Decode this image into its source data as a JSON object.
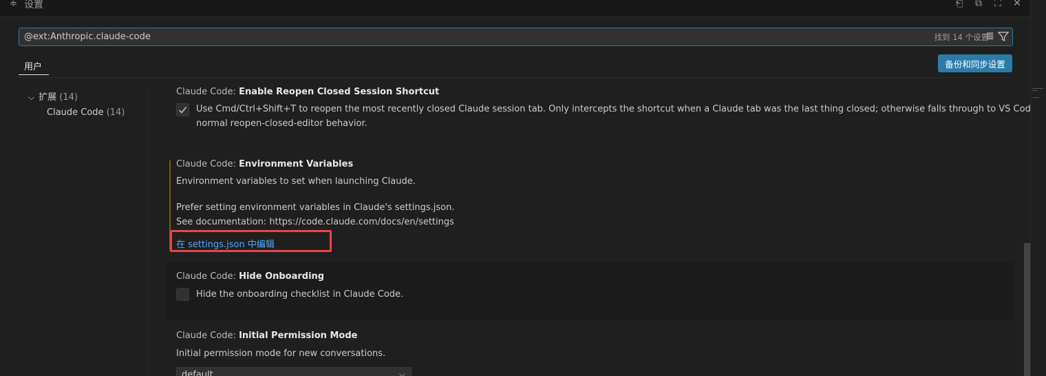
{
  "tab": {
    "title": "设置",
    "icon": "settings-sliders-icon"
  },
  "tab_actions": [
    {
      "name": "open-json-icon",
      "glyph": "⎗"
    },
    {
      "name": "split-editor-icon",
      "glyph": "⧉"
    },
    {
      "name": "maximize-icon",
      "glyph": "⛶"
    },
    {
      "name": "close-icon",
      "glyph": "✕"
    }
  ],
  "search": {
    "value": "@ext:Anthropic.claude-code",
    "result_count": "找到 14 个设置",
    "clear_icon": "clear-filter-icon",
    "filter_icon": "filter-icon"
  },
  "scope": {
    "user_tab": "用户",
    "backup_button": "备份和同步设置"
  },
  "toc": {
    "group_label": "扩展",
    "group_count": "(14)",
    "item_label": "Claude Code",
    "item_count": "(14)"
  },
  "settings": [
    {
      "category": "Claude Code: ",
      "name": "Enable Reopen Closed Session Shortcut",
      "checked": true,
      "desc_line1": "Use Cmd/Ctrl+Shift+T to reopen the most recently closed Claude session tab. Only intercepts the shortcut when a Claude tab was the last thing closed; otherwise falls through to VS Code's",
      "desc_line2": "normal reopen-closed-editor behavior."
    },
    {
      "category": "Claude Code: ",
      "name": "Environment Variables",
      "desc_line1": "Environment variables to set when launching Claude.",
      "desc_line2": "Prefer setting environment variables in Claude's settings.json.",
      "desc_line3": "See documentation: https://code.claude.com/docs/en/settings",
      "edit_link": "在 settings.json 中编辑"
    },
    {
      "category": "Claude Code: ",
      "name": "Hide Onboarding",
      "checked": false,
      "desc_line1": "Hide the onboarding checklist in Claude Code."
    },
    {
      "category": "Claude Code: ",
      "name": "Initial Permission Mode",
      "desc_line1": "Initial permission mode for new conversations.",
      "select_value": "default"
    }
  ],
  "colors": {
    "accent": "#2a7bab",
    "link": "#4daafc",
    "highlight": "#e8464b",
    "modified": "#7a5b18"
  }
}
